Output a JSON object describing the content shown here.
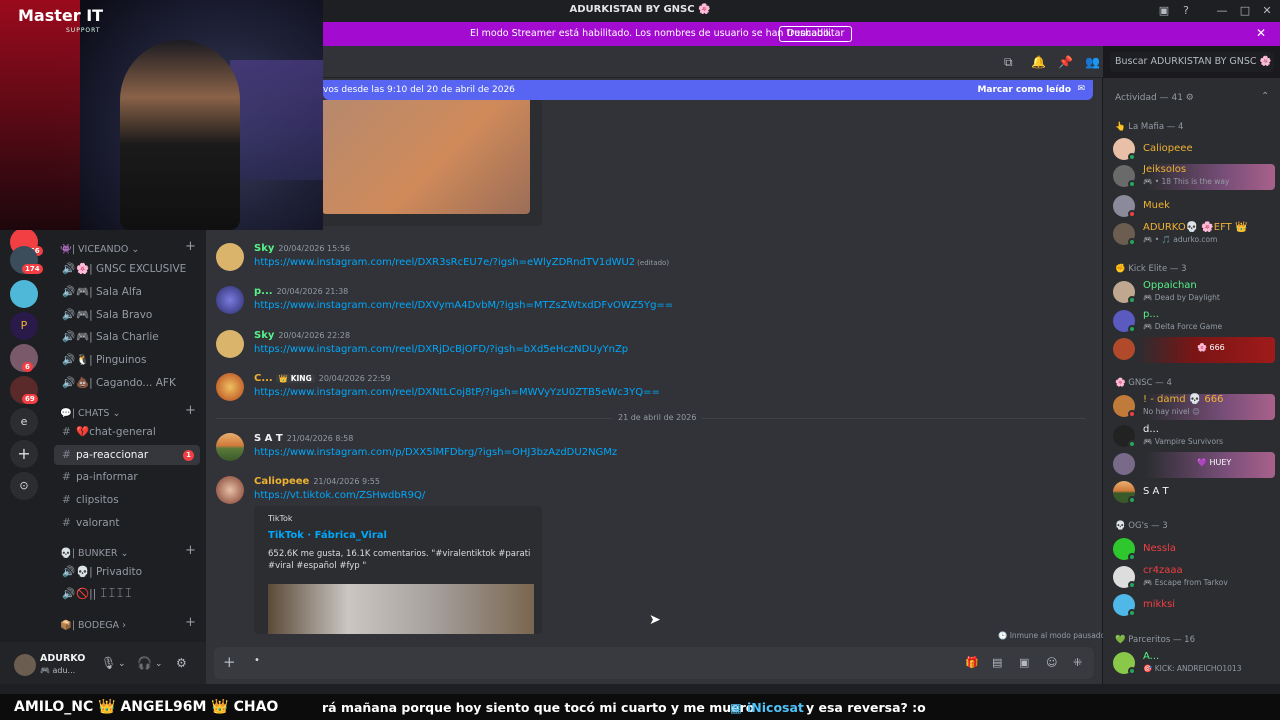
{
  "window": {
    "title": "ADURKISTAN BY GNSC 🌸"
  },
  "streamer_banner": {
    "message": "El modo Streamer está habilitado. Los nombres de usuario se han truncado.",
    "disable_label": "Deshabilitar"
  },
  "webcam": {
    "brand": "Master IT",
    "brand_sub": "SUPPORT"
  },
  "servers": [
    {
      "label": "",
      "count": "766"
    },
    {
      "label": "",
      "count": "174"
    },
    {
      "label": "",
      "count": ""
    },
    {
      "label": "P",
      "count": ""
    },
    {
      "label": "",
      "count": "6"
    },
    {
      "label": "",
      "count": "69"
    },
    {
      "label": "e",
      "count": ""
    },
    {
      "label": "+",
      "count": ""
    },
    {
      "label": "⊙",
      "count": ""
    }
  ],
  "channels": {
    "cat_viceando": "👾| VICEANDO ⌄",
    "cat_chats": "💬| CHATS ⌄",
    "cat_bunker": "💀| BUNKER ⌄",
    "cat_bodega": "📦| BODEGA ›",
    "items": [
      {
        "name": "🌸| GNSC EXCLUSIVE"
      },
      {
        "name": "🎮| Sala Alfa"
      },
      {
        "name": "🎮| Sala Bravo"
      },
      {
        "name": "🎮| Sala Charlie"
      },
      {
        "name": "🐧| Pinguinos"
      },
      {
        "name": "💩| Cagando... AFK"
      },
      {
        "name": "💔chat-general"
      },
      {
        "name": "pa-reaccionar",
        "badge": "1"
      },
      {
        "name": "pa-informar"
      },
      {
        "name": "clipsitos"
      },
      {
        "name": "valorant"
      },
      {
        "name": "💀| Privadito"
      },
      {
        "name": "🚫|| ꀤꀤꀤꀤ"
      }
    ]
  },
  "user_panel": {
    "name": "ADURKO",
    "status": "🎮 adu..."
  },
  "header": {
    "search_placeholder": "Buscar ADURKISTAN BY GNSC 🌸"
  },
  "new_messages_bar": {
    "text": "vos desde las 9:10 del 20 de abril de 2026",
    "mark_read": "Marcar como leído"
  },
  "messages": [
    {
      "author": "Sky",
      "color": "#57f287",
      "time": "20/04/2026 15:56",
      "link": "https://www.instagram.com/reel/DXR3sRcEU7e/?igsh=eWlyZDRndTV1dWU2",
      "edited": "(editado)"
    },
    {
      "author": "p...",
      "color": "#57f287",
      "time": "20/04/2026 21:38",
      "link": "https://www.instagram.com/reel/DXVymA4DvbM/?igsh=MTZsZWtxdDFvOWZ5Yg=="
    },
    {
      "author": "Sky",
      "color": "#57f287",
      "time": "20/04/2026 22:28",
      "link": "https://www.instagram.com/reel/DXRjDcBjOFD/?igsh=bXd5eHczNDUyYnZp"
    },
    {
      "author": "C...",
      "color": "#f0b232",
      "tag": "👑 KING",
      "time": "20/04/2026 22:59",
      "link": "https://www.instagram.com/reel/DXNtLCoj8tP/?igsh=MWVyYzU0ZTB5eWc3YQ=="
    },
    {
      "author": "S A T",
      "color": "#f2f3f5",
      "time": "21/04/2026 8:58",
      "link": "https://www.instagram.com/p/DXX5lMFDbrg/?igsh=OHJ3bzAzdDU2NGMz"
    },
    {
      "author": "Caliopeee",
      "color": "#f0b232",
      "time": "21/04/2026 9:55",
      "link": "https://vt.tiktok.com/ZSHwdbR9Q/"
    }
  ],
  "date_divider": "21 de abril de 2026",
  "tiktok_embed": {
    "provider": "TikTok",
    "title": "TikTok · Fábrica_Viral",
    "description": "652.6K me gusta, 16.1K comentarios. \"#viralentiktok #parati #viral #español #fyp \""
  },
  "pause_note": "🕒 Inmune al modo pausado",
  "composer": {
    "plus": "+",
    "text": "•"
  },
  "members": {
    "activity": "Actividad — 41 ⚙",
    "groups": [
      {
        "label": "👆 La Mafia — 4"
      },
      {
        "label": "✊ Kick Elite — 3"
      },
      {
        "label": "🌸 GNSC — 4"
      },
      {
        "label": "💀 OG's — 3"
      },
      {
        "label": "💚 Parceritos — 16"
      }
    ],
    "list": [
      {
        "name": "Caliopeee",
        "color": "#f0b232",
        "sub": ""
      },
      {
        "name": "Jeiksolos",
        "color": "#f0b232",
        "sub": "🎮 • 18  This is the way"
      },
      {
        "name": "Muek",
        "color": "#f0b232",
        "sub": ""
      },
      {
        "name": "ADURKO💀 🌸EFT 👑",
        "color": "#f0b232",
        "sub": "🎮 • 🎵 adurko.com"
      },
      {
        "name": "Oppaichan",
        "color": "#57f287",
        "sub": "🎮 Dead by Daylight"
      },
      {
        "name": "p...",
        "color": "#57f287",
        "sub": "🎮 Delta Force Game"
      },
      {
        "name": "🌸 666",
        "color": "#e84a8f",
        "sub": ""
      },
      {
        "name": "! - damd 💀 666",
        "color": "#f0b232",
        "sub": "No hay nivel 😊"
      },
      {
        "name": "d...",
        "color": "#f2f3f5",
        "sub": "🎮 Vampire Survivors"
      },
      {
        "name": "💜 HUEY",
        "color": "#e84a8f",
        "sub": ""
      },
      {
        "name": "S A T",
        "color": "#f2f3f5",
        "sub": ""
      },
      {
        "name": "Nessla",
        "color": "#f23f43",
        "sub": ""
      },
      {
        "name": "cr4zaaa",
        "color": "#f23f43",
        "sub": "🎮 Escape from Tarkov"
      },
      {
        "name": "mikksi",
        "color": "#f23f43",
        "sub": ""
      },
      {
        "name": "A...",
        "color": "#57f287",
        "sub": "🎯 KICK: ANDREICHO1013"
      }
    ]
  },
  "ticker": {
    "left": "AMILO_NC 👑 ANGEL96M 👑 CHAO",
    "middle": "rá mañana porque hoy siento que tocó mi cuarto y me muero",
    "user": "iNicosat",
    "tail": "y esa reversa? :o"
  }
}
